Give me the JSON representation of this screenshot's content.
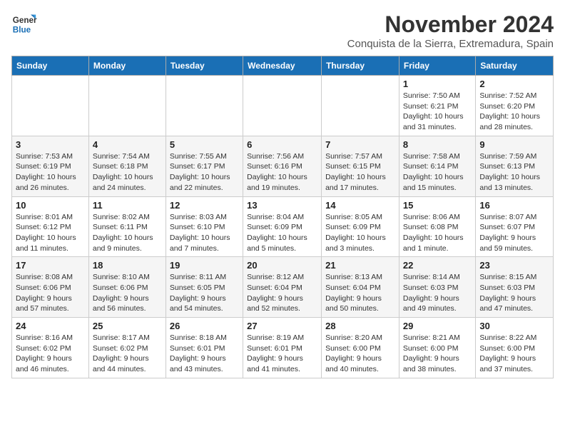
{
  "logo": {
    "line1": "General",
    "line2": "Blue"
  },
  "title": "November 2024",
  "subtitle": "Conquista de la Sierra, Extremadura, Spain",
  "weekdays": [
    "Sunday",
    "Monday",
    "Tuesday",
    "Wednesday",
    "Thursday",
    "Friday",
    "Saturday"
  ],
  "weeks": [
    [
      {
        "day": "",
        "detail": ""
      },
      {
        "day": "",
        "detail": ""
      },
      {
        "day": "",
        "detail": ""
      },
      {
        "day": "",
        "detail": ""
      },
      {
        "day": "",
        "detail": ""
      },
      {
        "day": "1",
        "detail": "Sunrise: 7:50 AM\nSunset: 6:21 PM\nDaylight: 10 hours and 31 minutes."
      },
      {
        "day": "2",
        "detail": "Sunrise: 7:52 AM\nSunset: 6:20 PM\nDaylight: 10 hours and 28 minutes."
      }
    ],
    [
      {
        "day": "3",
        "detail": "Sunrise: 7:53 AM\nSunset: 6:19 PM\nDaylight: 10 hours and 26 minutes."
      },
      {
        "day": "4",
        "detail": "Sunrise: 7:54 AM\nSunset: 6:18 PM\nDaylight: 10 hours and 24 minutes."
      },
      {
        "day": "5",
        "detail": "Sunrise: 7:55 AM\nSunset: 6:17 PM\nDaylight: 10 hours and 22 minutes."
      },
      {
        "day": "6",
        "detail": "Sunrise: 7:56 AM\nSunset: 6:16 PM\nDaylight: 10 hours and 19 minutes."
      },
      {
        "day": "7",
        "detail": "Sunrise: 7:57 AM\nSunset: 6:15 PM\nDaylight: 10 hours and 17 minutes."
      },
      {
        "day": "8",
        "detail": "Sunrise: 7:58 AM\nSunset: 6:14 PM\nDaylight: 10 hours and 15 minutes."
      },
      {
        "day": "9",
        "detail": "Sunrise: 7:59 AM\nSunset: 6:13 PM\nDaylight: 10 hours and 13 minutes."
      }
    ],
    [
      {
        "day": "10",
        "detail": "Sunrise: 8:01 AM\nSunset: 6:12 PM\nDaylight: 10 hours and 11 minutes."
      },
      {
        "day": "11",
        "detail": "Sunrise: 8:02 AM\nSunset: 6:11 PM\nDaylight: 10 hours and 9 minutes."
      },
      {
        "day": "12",
        "detail": "Sunrise: 8:03 AM\nSunset: 6:10 PM\nDaylight: 10 hours and 7 minutes."
      },
      {
        "day": "13",
        "detail": "Sunrise: 8:04 AM\nSunset: 6:09 PM\nDaylight: 10 hours and 5 minutes."
      },
      {
        "day": "14",
        "detail": "Sunrise: 8:05 AM\nSunset: 6:09 PM\nDaylight: 10 hours and 3 minutes."
      },
      {
        "day": "15",
        "detail": "Sunrise: 8:06 AM\nSunset: 6:08 PM\nDaylight: 10 hours and 1 minute."
      },
      {
        "day": "16",
        "detail": "Sunrise: 8:07 AM\nSunset: 6:07 PM\nDaylight: 9 hours and 59 minutes."
      }
    ],
    [
      {
        "day": "17",
        "detail": "Sunrise: 8:08 AM\nSunset: 6:06 PM\nDaylight: 9 hours and 57 minutes."
      },
      {
        "day": "18",
        "detail": "Sunrise: 8:10 AM\nSunset: 6:06 PM\nDaylight: 9 hours and 56 minutes."
      },
      {
        "day": "19",
        "detail": "Sunrise: 8:11 AM\nSunset: 6:05 PM\nDaylight: 9 hours and 54 minutes."
      },
      {
        "day": "20",
        "detail": "Sunrise: 8:12 AM\nSunset: 6:04 PM\nDaylight: 9 hours and 52 minutes."
      },
      {
        "day": "21",
        "detail": "Sunrise: 8:13 AM\nSunset: 6:04 PM\nDaylight: 9 hours and 50 minutes."
      },
      {
        "day": "22",
        "detail": "Sunrise: 8:14 AM\nSunset: 6:03 PM\nDaylight: 9 hours and 49 minutes."
      },
      {
        "day": "23",
        "detail": "Sunrise: 8:15 AM\nSunset: 6:03 PM\nDaylight: 9 hours and 47 minutes."
      }
    ],
    [
      {
        "day": "24",
        "detail": "Sunrise: 8:16 AM\nSunset: 6:02 PM\nDaylight: 9 hours and 46 minutes."
      },
      {
        "day": "25",
        "detail": "Sunrise: 8:17 AM\nSunset: 6:02 PM\nDaylight: 9 hours and 44 minutes."
      },
      {
        "day": "26",
        "detail": "Sunrise: 8:18 AM\nSunset: 6:01 PM\nDaylight: 9 hours and 43 minutes."
      },
      {
        "day": "27",
        "detail": "Sunrise: 8:19 AM\nSunset: 6:01 PM\nDaylight: 9 hours and 41 minutes."
      },
      {
        "day": "28",
        "detail": "Sunrise: 8:20 AM\nSunset: 6:00 PM\nDaylight: 9 hours and 40 minutes."
      },
      {
        "day": "29",
        "detail": "Sunrise: 8:21 AM\nSunset: 6:00 PM\nDaylight: 9 hours and 38 minutes."
      },
      {
        "day": "30",
        "detail": "Sunrise: 8:22 AM\nSunset: 6:00 PM\nDaylight: 9 hours and 37 minutes."
      }
    ]
  ]
}
